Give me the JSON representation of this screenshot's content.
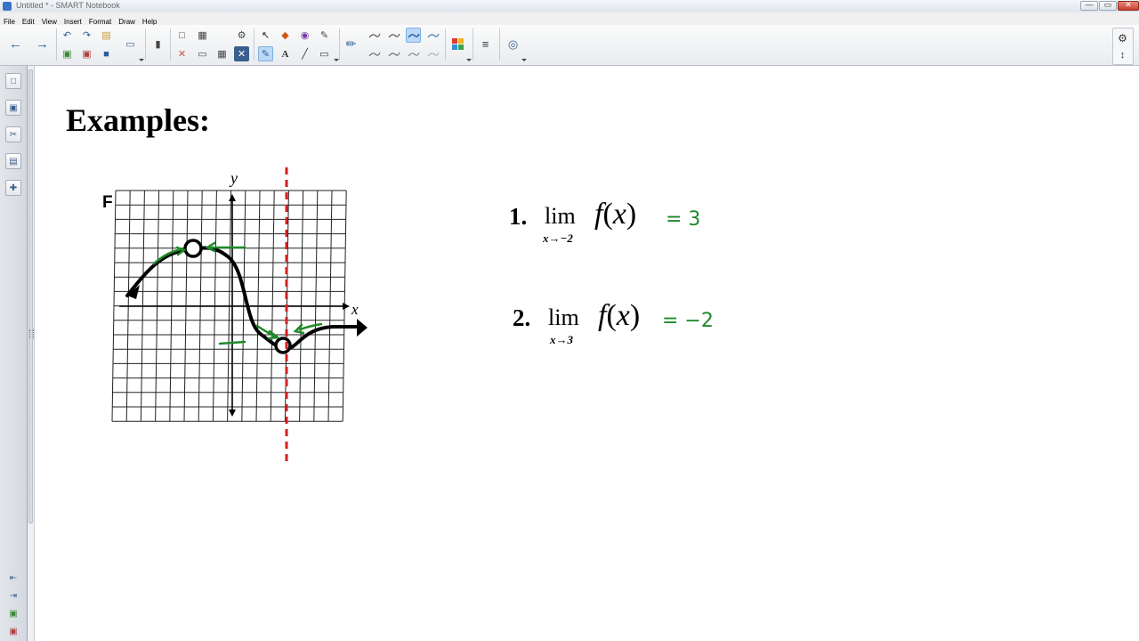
{
  "window": {
    "title": "Untitled * - SMART Notebook",
    "minimize": "—",
    "maximize": "▭",
    "close": "✕"
  },
  "menu": [
    "File",
    "Edit",
    "View",
    "Insert",
    "Format",
    "Draw",
    "Help"
  ],
  "page": {
    "heading": "Examples:",
    "graph": {
      "panel_label": "F",
      "y_axis_label": "y",
      "x_axis_label": "x"
    },
    "problems": [
      {
        "number": "1.",
        "lim": "lim",
        "subscript": "x→−2",
        "func": "f",
        "var": "x",
        "answer": "= 3"
      },
      {
        "number": "2.",
        "lim": "lim",
        "subscript": "x→3",
        "func": "f",
        "var": "x",
        "answer": "= −2"
      }
    ]
  },
  "colors": {
    "annotation_green": "#1f8a2a",
    "guide_red": "#d42020"
  }
}
